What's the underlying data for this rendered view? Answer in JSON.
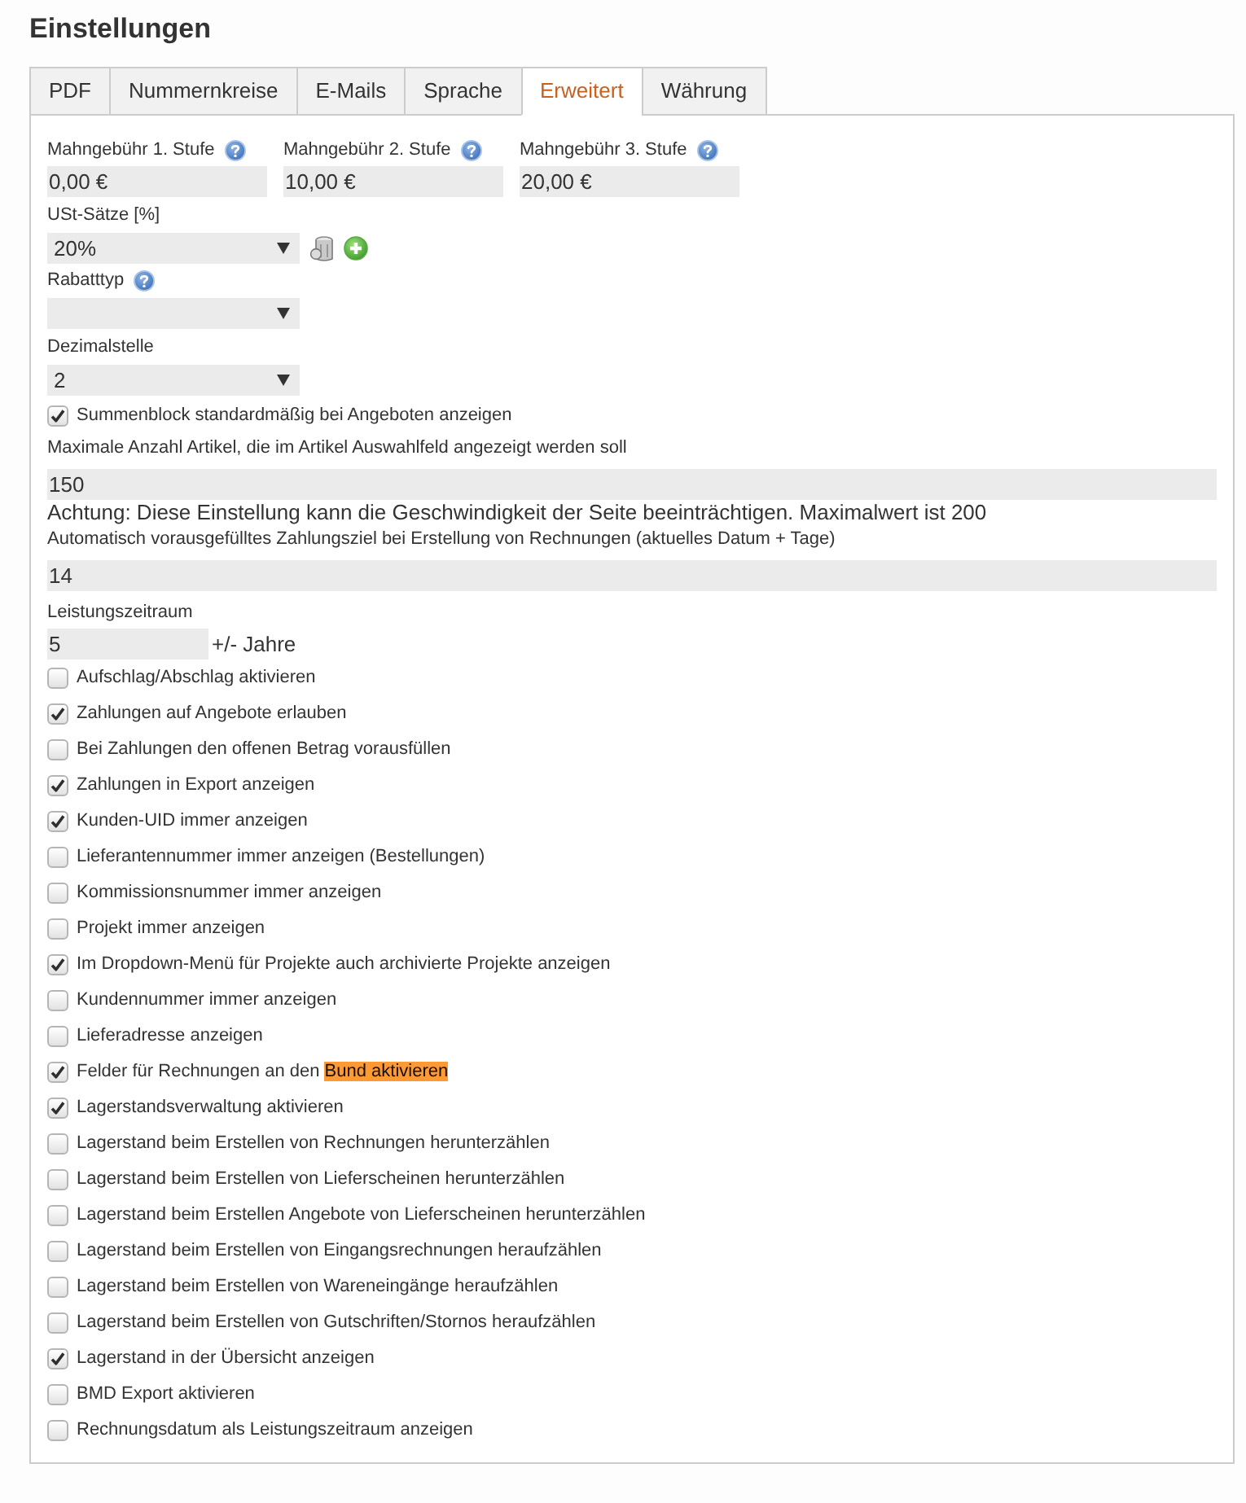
{
  "title": "Einstellungen",
  "tabs": [
    {
      "label": "PDF",
      "selected": false
    },
    {
      "label": "Nummernkreise",
      "selected": false
    },
    {
      "label": "E-Mails",
      "selected": false
    },
    {
      "label": "Sprache",
      "selected": false
    },
    {
      "label": "Erweitert",
      "selected": true
    },
    {
      "label": "Währung",
      "selected": false
    }
  ],
  "fees": [
    {
      "label": "Mahngebühr 1. Stufe",
      "value": "0,00 €",
      "help": true
    },
    {
      "label": "Mahngebühr 2. Stufe",
      "value": "10,00 €",
      "help": true
    },
    {
      "label": "Mahngebühr 3. Stufe",
      "value": "20,00 €",
      "help": true
    }
  ],
  "selects": [
    {
      "label": "USt-Sätze [%]",
      "value": "20%",
      "help": false,
      "actions": true
    },
    {
      "label": "Rabatttyp",
      "help": true,
      "actions": false
    },
    {
      "label": "Dezimalstelle",
      "value": "2",
      "help": false,
      "actions": false
    }
  ],
  "summary_option": {
    "label": "Summenblock standardmäßig bei Angeboten anzeigen",
    "checked": true
  },
  "text_fields": [
    {
      "kind": "wide",
      "label": "Maximale Anzahl Artikel, die im Artikel Auswahlfeld angezeigt werden soll",
      "value": "150",
      "hint": "Achtung: Diese Einstellung kann die Geschwindigkeit der Seite beeinträchtigen. Maximalwert ist 200"
    },
    {
      "kind": "wide",
      "label": "Automatisch vorausgefülltes Zahlungsziel bei Erstellung von Rechnungen (aktuelles Datum + Tage)",
      "value": "14"
    },
    {
      "kind": "short",
      "label": "Leistungszeitraum",
      "value": "5",
      "suffix": "+/- Jahre"
    }
  ],
  "options": [
    {
      "label": "Aufschlag/Abschlag aktivieren",
      "checked": false
    },
    {
      "label": "Zahlungen auf Angebote erlauben",
      "checked": true
    },
    {
      "label": "Bei Zahlungen den offenen Betrag vorausfüllen",
      "checked": false
    },
    {
      "label": "Zahlungen in Export anzeigen",
      "checked": true
    },
    {
      "label": "Kunden-UID immer anzeigen",
      "checked": true
    },
    {
      "label": "Lieferantennummer immer anzeigen (Bestellungen)",
      "checked": false
    },
    {
      "label": "Kommissionsnummer immer anzeigen",
      "checked": false
    },
    {
      "label": "Projekt immer anzeigen",
      "checked": false
    },
    {
      "label": "Im Dropdown-Menü für Projekte auch archivierte Projekte anzeigen",
      "checked": true
    },
    {
      "label": "Kundennummer immer anzeigen",
      "checked": false
    },
    {
      "label": "Lieferadresse anzeigen",
      "checked": false
    },
    {
      "label": "Felder für Rechnungen an den",
      "highlight": "Bund aktivieren",
      "checked": true
    },
    {
      "label": "Lagerstandsverwaltung aktivieren",
      "checked": true
    },
    {
      "label": "Lagerstand beim Erstellen von Rechnungen herunterzählen",
      "checked": false
    },
    {
      "label": "Lagerstand beim Erstellen von Lieferscheinen herunterzählen",
      "checked": false
    },
    {
      "label": "Lagerstand beim Erstellen Angebote von Lieferscheinen herunterzählen",
      "checked": false
    },
    {
      "label": "Lagerstand beim Erstellen von Eingangsrechnungen heraufzählen",
      "checked": false
    },
    {
      "label": "Lagerstand beim Erstellen von Wareneingänge heraufzählen",
      "checked": false
    },
    {
      "label": "Lagerstand beim Erstellen von Gutschriften/Stornos heraufzählen",
      "checked": false
    },
    {
      "label": "Lagerstand in der Übersicht anzeigen",
      "checked": true
    },
    {
      "label": "BMD Export aktivieren",
      "checked": false
    },
    {
      "label": "Rechnungsdatum als Leistungszeitraum anzeigen",
      "checked": false
    }
  ]
}
